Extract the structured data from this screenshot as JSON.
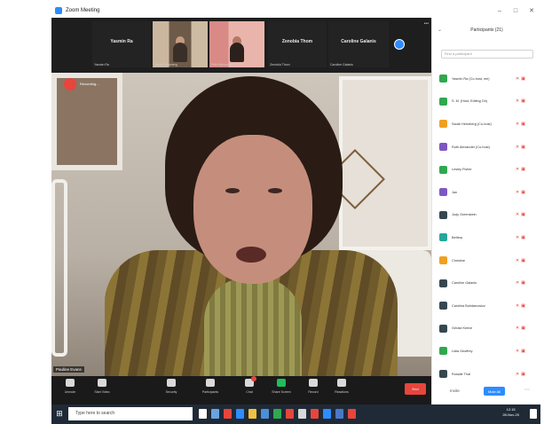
{
  "window": {
    "title": "Zoom Meeting"
  },
  "gallery": [
    {
      "name": "Yasmin Ra",
      "label": "Yasmin Ra",
      "type": "name"
    },
    {
      "name": "",
      "label": "Sarah Hertzberg",
      "type": "video"
    },
    {
      "name": "",
      "label": "Ruth Alexander",
      "type": "video"
    },
    {
      "name": "Zenobia Thom",
      "label": "Zenobia Thom",
      "type": "name"
    },
    {
      "name": "Caroline Galanis",
      "label": "Caroline Galanis",
      "type": "name"
    }
  ],
  "speaker": {
    "name": "Pauline Evans",
    "recording_label": "Recording..."
  },
  "toolbar": {
    "items": [
      {
        "label": "Unmute",
        "icon": "microphone-icon"
      },
      {
        "label": "Start Video",
        "icon": "video-camera-icon"
      },
      {
        "label": "Security",
        "icon": "shield-icon"
      },
      {
        "label": "Participants",
        "icon": "participants-icon"
      },
      {
        "label": "Chat",
        "icon": "chat-icon"
      },
      {
        "label": "Share Screen",
        "icon": "share-screen-icon"
      },
      {
        "label": "Record",
        "icon": "record-icon"
      },
      {
        "label": "Reactions",
        "icon": "reactions-icon"
      }
    ],
    "end_label": "End"
  },
  "participants_panel": {
    "title": "Participants (21)",
    "search_placeholder": "Find a participant",
    "participants": [
      {
        "name": "Yasmin Ra (Co-host, me)",
        "color": "#2fa84f"
      },
      {
        "name": "S. M. (Host, Editing On)",
        "color": "#2fa84f"
      },
      {
        "name": "Sarah Hertzberg (Co-host)",
        "color": "#f0a020"
      },
      {
        "name": "Ruth Alexander (Co-host)",
        "color": "#7e57c2"
      },
      {
        "name": "Lesley Fisher",
        "color": "#2fa84f"
      },
      {
        "name": "Jan",
        "color": "#7e57c2"
      },
      {
        "name": "Judy Greenstein",
        "color": "#37474f"
      },
      {
        "name": "Bettina",
        "color": "#26a69a"
      },
      {
        "name": "Christine",
        "color": "#f0a020"
      },
      {
        "name": "Caroline Galanis",
        "color": "#37474f"
      },
      {
        "name": "Carolina Bohdanowicz",
        "color": "#37474f"
      },
      {
        "name": "Gerald Keeve",
        "color": "#37474f"
      },
      {
        "name": "Lidia Geoffrey",
        "color": "#2fa84f"
      },
      {
        "name": "Rosalie Thal",
        "color": "#37474f"
      }
    ],
    "invite_label": "Invite",
    "mute_all_label": "Mute All"
  },
  "taskbar": {
    "search_placeholder": "Type here to search",
    "time": "12:15",
    "date": "28-Nov-20"
  }
}
